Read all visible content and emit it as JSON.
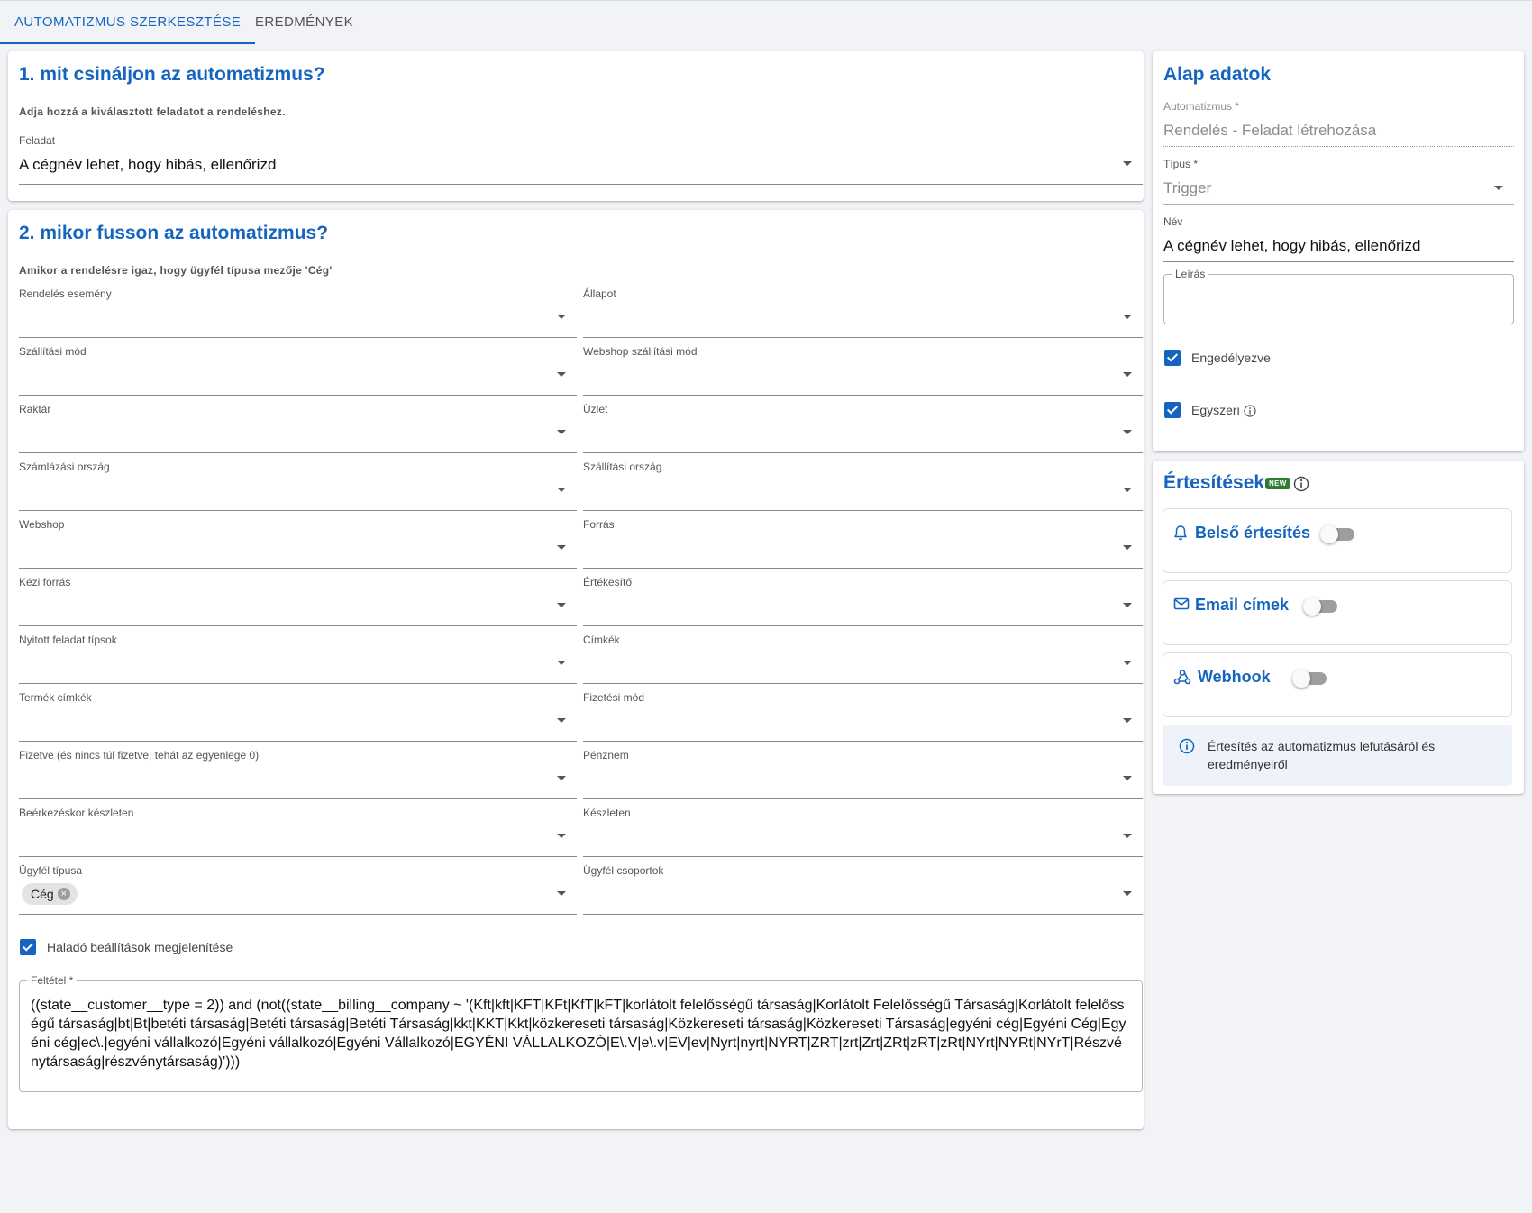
{
  "tabs": [
    {
      "label": "AUTOMATIZMUS SZERKESZTÉSE",
      "active": true
    },
    {
      "label": "EREDMÉNYEK",
      "active": false
    }
  ],
  "section1": {
    "title": "1. mit csináljon az automatizmus?",
    "description": "Adja hozzá a kiválasztott feladatot a rendeléshez.",
    "task_label": "Feladat",
    "task_value": "A cégnév lehet, hogy hibás, ellenőrizd"
  },
  "section2": {
    "title": "2. mikor fusson az automatizmus?",
    "description": "Amikor a rendelésre igaz, hogy ügyfél típusa mezője 'Cég'",
    "fields": [
      {
        "label": "Rendelés esemény",
        "value": ""
      },
      {
        "label": "Állapot",
        "value": ""
      },
      {
        "label": "Szállítási mód",
        "value": ""
      },
      {
        "label": "Webshop szállítási mód",
        "value": ""
      },
      {
        "label": "Raktár",
        "value": ""
      },
      {
        "label": "Üzlet",
        "value": ""
      },
      {
        "label": "Számlázási ország",
        "value": ""
      },
      {
        "label": "Szállítási ország",
        "value": ""
      },
      {
        "label": "Webshop",
        "value": ""
      },
      {
        "label": "Forrás",
        "value": ""
      },
      {
        "label": "Kézi forrás",
        "value": ""
      },
      {
        "label": "Értékesítő",
        "value": ""
      },
      {
        "label": "Nyitott feladat típsok",
        "value": ""
      },
      {
        "label": "Címkék",
        "value": ""
      },
      {
        "label": "Termék címkék",
        "value": ""
      },
      {
        "label": "Fizetési mód",
        "value": ""
      },
      {
        "label": "Fizetve (és nincs túl fizetve, tehát az egyenlege 0)",
        "value": ""
      },
      {
        "label": "Pénznem",
        "value": ""
      },
      {
        "label": "Beérkezéskor készleten",
        "value": ""
      },
      {
        "label": "Készleten",
        "value": ""
      },
      {
        "label": "Ügyfél típusa",
        "chip": "Cég"
      },
      {
        "label": "Ügyfél csoportok",
        "value": ""
      }
    ],
    "advanced_label": "Haladó beállítások megjelenítése",
    "advanced_checked": true,
    "condition_label": "Feltétel *",
    "condition_value": "((state__customer__type = 2)) and (not((state__billing__company ~ '(Kft|kft|KFT|KFt|KfT|kFT|korlátolt felelősségű társaság|Korlátolt Felelősségű Társaság|Korlátolt felelősségű társaság|bt|Bt|betéti társaság|Betéti társaság|Betéti Társaság|kkt|KKT|Kkt|közkereseti társaság|Közkereseti társaság|Közkereseti Társaság|egyéni cég|Egyéni Cég|Egyéni cég|ec\\.|egyéni vállalkozó|Egyéni vállalkozó|Egyéni Vállalkozó|EGYÉNI VÁLLALKOZÓ|E\\.V|e\\.v|EV|ev|Nyrt|nyrt|NYRT|ZRT|zrt|Zrt|ZRt|zRT|zRt|NYrt|NYRt|NYrT|Részvénytársaság|részvénytársaság)')))"
  },
  "basic": {
    "title": "Alap adatok",
    "automation_label": "Automatizmus *",
    "automation_value": "Rendelés - Feladat létrehozása",
    "type_label": "Típus *",
    "type_value": "Trigger",
    "name_label": "Név",
    "name_value": "A cégnév lehet, hogy hibás, ellenőrizd",
    "description_label": "Leírás",
    "description_value": "",
    "enabled_label": "Engedélyezve",
    "enabled_checked": true,
    "once_label": "Egyszeri",
    "once_checked": true
  },
  "notifications": {
    "title": "Értesítések",
    "badge": "NEW",
    "items": [
      {
        "label": "Belső értesítés",
        "icon": "bell-icon",
        "enabled": false
      },
      {
        "label": "Email címek",
        "icon": "mail-icon",
        "enabled": false
      },
      {
        "label": "Webhook",
        "icon": "webhook-icon",
        "enabled": false
      }
    ],
    "info_text": "Értesítés az automatizmus lefutásáról és eredményeiről"
  },
  "colors": {
    "accent": "#1565c0",
    "background": "#f1f3f6",
    "badge_green": "#2e7d32"
  }
}
